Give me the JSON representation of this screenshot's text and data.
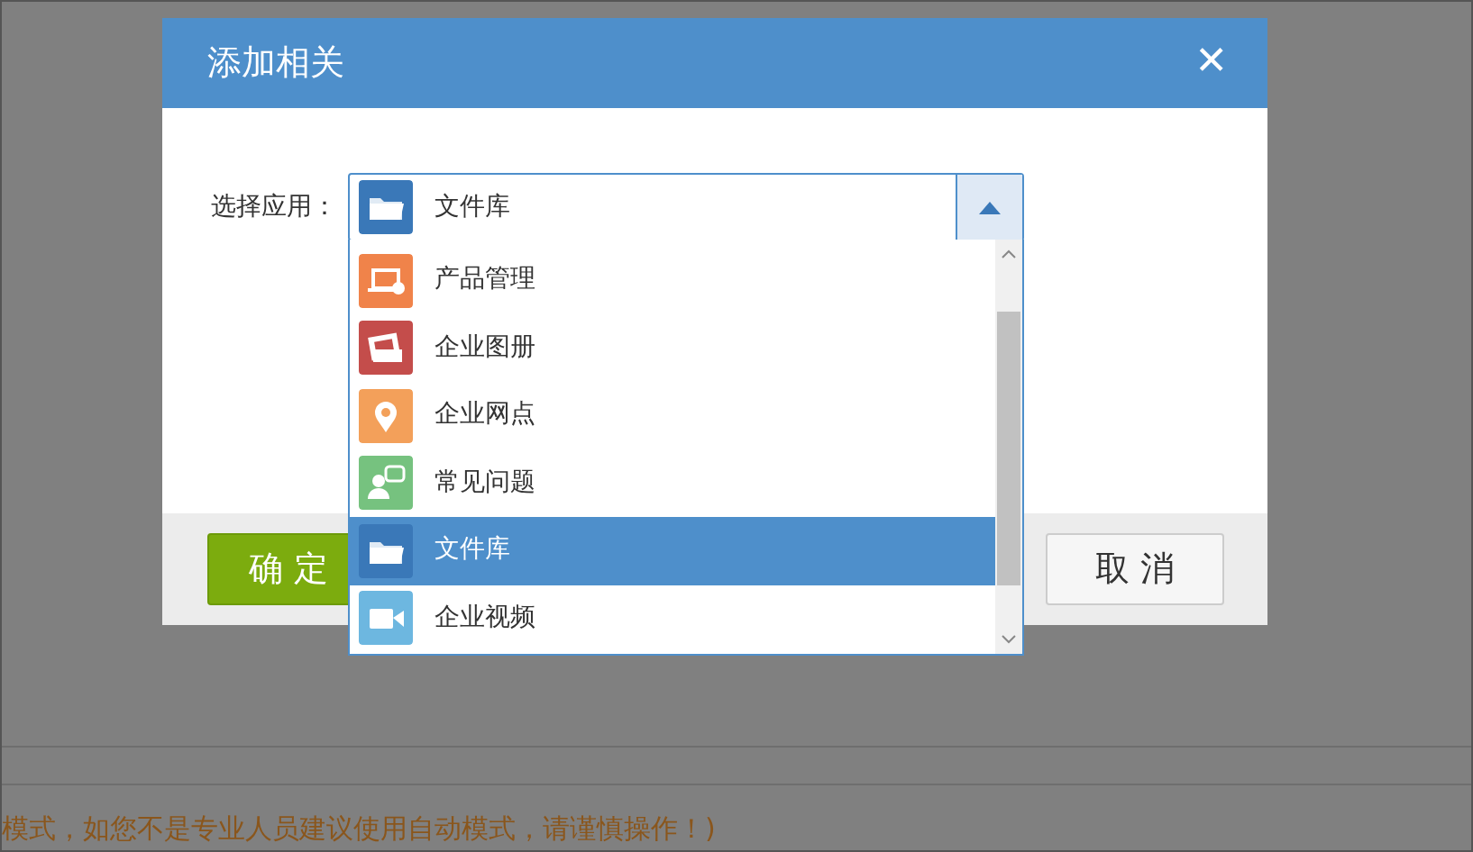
{
  "dialog": {
    "title": "添加相关",
    "close": "✕",
    "select": {
      "label": "选择应用：",
      "value": "文件库",
      "kind": "folder",
      "color": "#3a78b8",
      "expanded": true,
      "options": [
        {
          "label": "产品管理",
          "kind": "laptop",
          "color": "#f0834a",
          "selected": false
        },
        {
          "label": "企业图册",
          "kind": "album",
          "color": "#c44d4b",
          "selected": false
        },
        {
          "label": "企业网点",
          "kind": "pin",
          "color": "#f3a05a",
          "selected": false
        },
        {
          "label": "常见问题",
          "kind": "chat",
          "color": "#76c27f",
          "selected": false
        },
        {
          "label": "文件库",
          "kind": "folder",
          "color": "#3a78b8",
          "selected": true
        },
        {
          "label": "企业视频",
          "kind": "video",
          "color": "#6db7e0",
          "selected": false
        }
      ]
    },
    "buttons": [
      {
        "label": "确 定",
        "kind": "primary"
      },
      {
        "label": "取 消",
        "kind": "secondary"
      }
    ]
  },
  "page": {
    "notice": "模式，如您不是专业人员建议使用自动模式，请谨慎操作！)"
  }
}
